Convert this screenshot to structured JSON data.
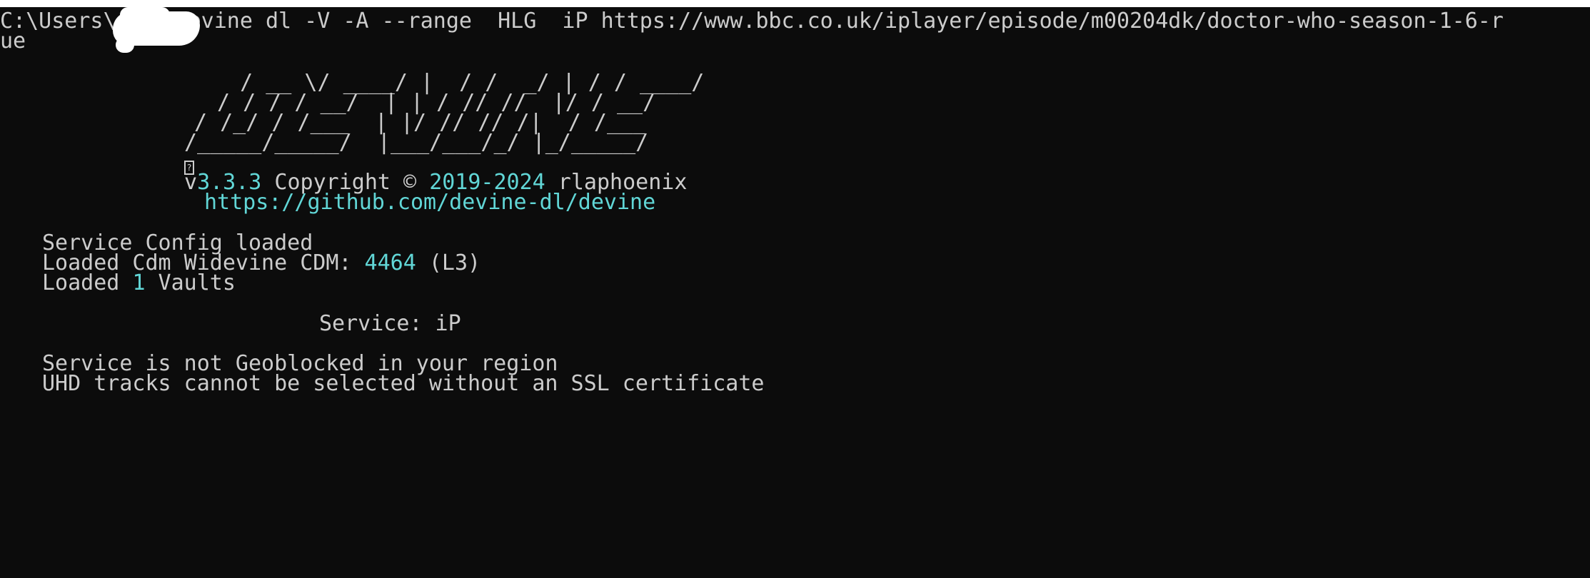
{
  "command": {
    "prompt_prefix": "C:\\Users\\",
    "command_text": "devine dl -V -A --range  HLG  iP https://www.bbc.co.uk/iplayer/episode/m00204dk/doctor-who-season-1-6-r",
    "wrap_text": "ue"
  },
  "banner": {
    "ascii_lines": [
      "  / __ \\/ ____/ |  / /  _/ | / / ____/",
      " / / / / __/  | | / // //  |/ / __/",
      "/ /_/ / /___  | |/ // // /|  / /___",
      "/_____/_____/  |___/___/_/ |_/_____/"
    ],
    "unknown_glyph": "?",
    "version_prefix": "v",
    "version": "3.3.3",
    "copyright_label": " Copyright © ",
    "years": "2019-2024",
    "author": " rlaphoenix",
    "url": "https://github.com/devine-dl/devine"
  },
  "log": {
    "config_loaded": "Service Config loaded",
    "cdm_prefix": "Loaded Cdm Widevine CDM: ",
    "cdm_id": "4464",
    "cdm_level": " (L3)",
    "vaults_prefix": "Loaded ",
    "vaults_count": "1",
    "vaults_suffix": " Vaults",
    "service_line": "Service: iP",
    "geoblock": "Service is not Geoblocked in your region",
    "uhd_warning": "UHD tracks cannot be selected without an SSL certificate"
  },
  "colors": {
    "background": "#0c0c0c",
    "foreground": "#cccccc",
    "accent_cyan": "#61d6d6"
  }
}
